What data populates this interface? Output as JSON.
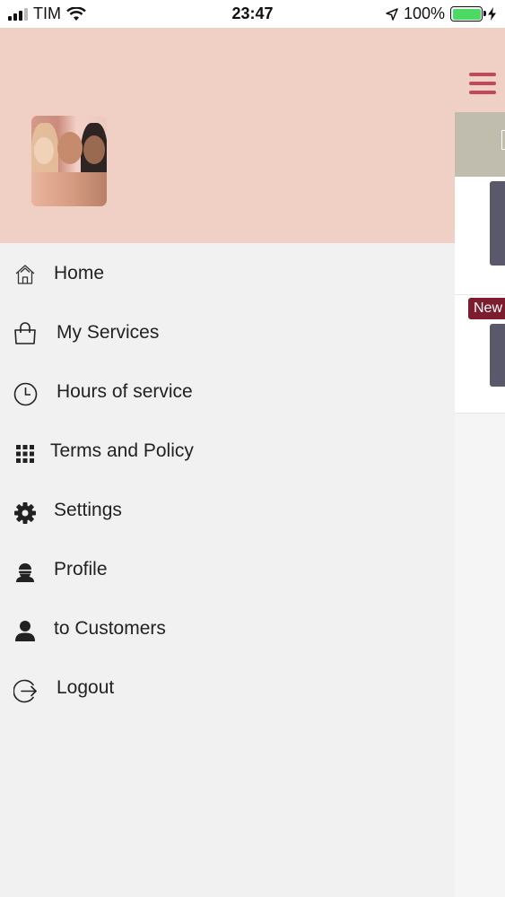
{
  "status_bar": {
    "carrier": "TIM",
    "time": "23:47",
    "battery_percent": "100%",
    "battery_level": 1.0,
    "battery_color": "#4cd964"
  },
  "drawer": {
    "header_color": "#f0cfc5",
    "menu": [
      {
        "label": "Home",
        "icon": "home-icon"
      },
      {
        "label": "My Services",
        "icon": "shopping-bag-icon"
      },
      {
        "label": "Hours of service",
        "icon": "clock-icon"
      },
      {
        "label": "Terms and Policy",
        "icon": "grid-icon"
      },
      {
        "label": "Settings",
        "icon": "gear-icon"
      },
      {
        "label": "Profile",
        "icon": "profile-icon"
      },
      {
        "label": "to Customers",
        "icon": "user-icon"
      },
      {
        "label": "Logout",
        "icon": "logout-icon"
      }
    ]
  },
  "background_app": {
    "badge": "New",
    "accent_color": "#c0485a",
    "badge_color": "#7b1d2e"
  }
}
